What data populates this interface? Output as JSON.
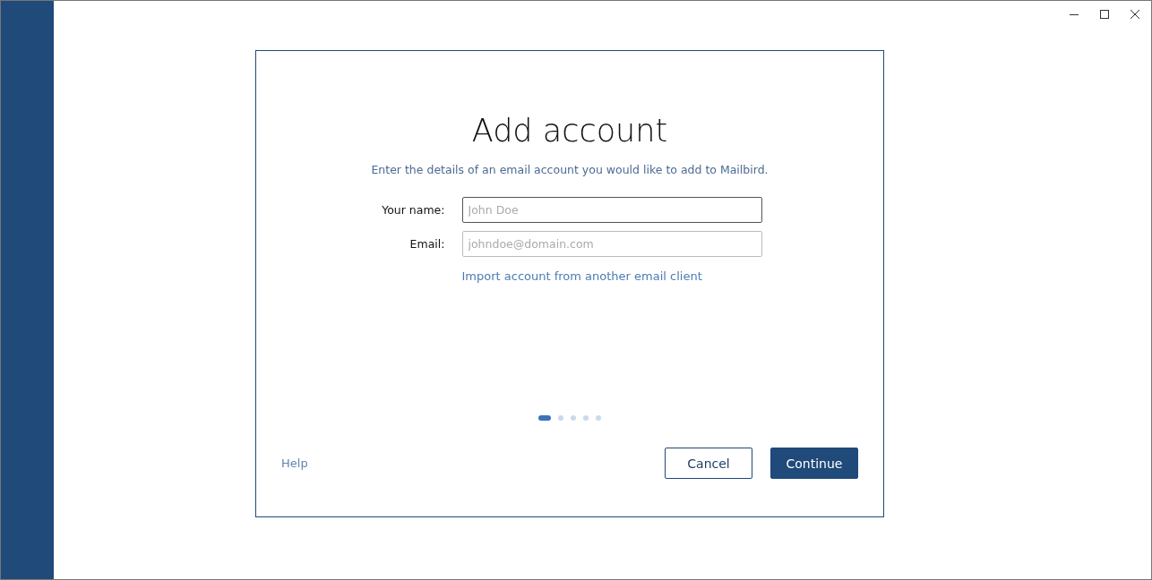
{
  "dialog": {
    "title": "Add account",
    "subtitle": "Enter the details of an email account you would like to add to Mailbird.",
    "fields": [
      {
        "label": "Your name:",
        "placeholder": "John Doe",
        "focused": true
      },
      {
        "label": "Email:",
        "placeholder": "johndoe@domain.com",
        "focused": false
      }
    ],
    "import_link": "Import account from another email client",
    "steps": [
      {
        "selected": true
      },
      {
        "selected": false
      },
      {
        "selected": false
      },
      {
        "selected": false
      },
      {
        "selected": false
      }
    ],
    "help_link": "Help",
    "buttons": [
      {
        "label": "Cancel",
        "kind": "secondary"
      },
      {
        "label": "Continue",
        "kind": "primary"
      }
    ]
  }
}
